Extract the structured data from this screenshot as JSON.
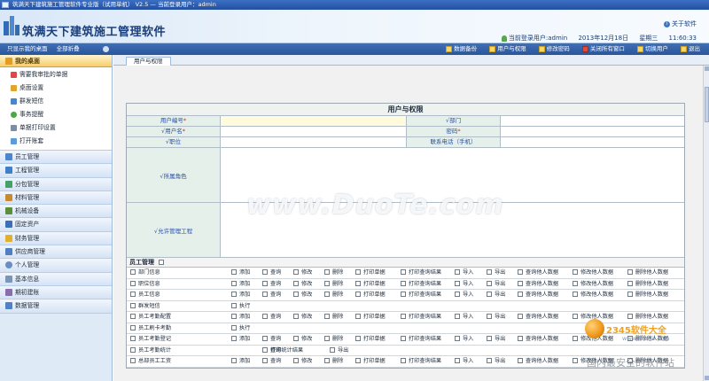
{
  "window": {
    "title": "筑满天下建筑施工管理软件专业版（试用单机） V2.5 —   当前登录用户：admin"
  },
  "header": {
    "app_name": "筑满天下建筑施工管理软件",
    "about_label": "关于软件",
    "current_user_label": "当前登录用户:admin",
    "date": "2013年12月18日",
    "weekday": "星期三",
    "time": "11:60:33"
  },
  "toolbar": {
    "left_links": [
      "只显示我的桌面",
      "全部折叠"
    ],
    "actions": [
      "数据备份",
      "用户与权限",
      "修改密码",
      "关闭所有窗口",
      "切换用户",
      "退出"
    ]
  },
  "sidebar": {
    "my_desktop": {
      "label": "我的桌面",
      "items": [
        "需要我审批的单据",
        "桌面设置",
        "群发短信",
        "事务提醒",
        "单据打印设置",
        "打开账套"
      ]
    },
    "modules": [
      "员工管理",
      "工程管理",
      "分包管理",
      "材料管理",
      "机械设备",
      "固定资产",
      "财务管理",
      "供应商管理",
      "个人管理",
      "基本信息",
      "期初建账",
      "数据管理"
    ]
  },
  "tab": {
    "label": "用户与权限"
  },
  "form": {
    "title": "用户与权限",
    "fields": {
      "user_no": "用户编号",
      "dept": "√部门",
      "username": "√用户名",
      "password": "密码",
      "position": "√职位",
      "phone": "联系电话（手机）",
      "roles": "√所属角色",
      "projects": "√允许管理工程"
    },
    "required_mark": "*",
    "perm_section": "员工管理",
    "perm_rows": [
      {
        "name": "部门信息",
        "ops": [
          "添加",
          "查询",
          "修改",
          "删除",
          "打印单据",
          "打印查询结果",
          "导入",
          "导出",
          "查询他人数据",
          "修改他人数据",
          "删除他人数据"
        ]
      },
      {
        "name": "职位信息",
        "ops": [
          "添加",
          "查询",
          "修改",
          "删除",
          "打印单据",
          "打印查询结果",
          "导入",
          "导出",
          "查询他人数据",
          "修改他人数据",
          "删除他人数据"
        ]
      },
      {
        "name": "员工信息",
        "ops": [
          "添加",
          "查询",
          "修改",
          "删除",
          "打印单据",
          "打印查询结果",
          "导入",
          "导出",
          "查询他人数据",
          "修改他人数据",
          "删除他人数据"
        ]
      },
      {
        "name": "群发短信",
        "ops": [
          "执行"
        ]
      },
      {
        "name": "员工考勤配置",
        "ops": [
          "添加",
          "查询",
          "修改",
          "删除",
          "打印单据",
          "打印查询结果",
          "导入",
          "导出",
          "查询他人数据",
          "修改他人数据",
          "删除他人数据"
        ]
      },
      {
        "name": "员工刷卡考勤",
        "ops": [
          "执行"
        ]
      },
      {
        "name": "员工考勤登记",
        "ops": [
          "添加",
          "查询",
          "修改",
          "删除",
          "打印单据",
          "打印查询结果",
          "导入",
          "导出",
          "查询他人数据",
          "修改他人数据",
          "删除他人数据"
        ]
      },
      {
        "name": "员工考勤统计",
        "ops": [
          "查询",
          "打印统计结果",
          "导出"
        ]
      },
      {
        "name": "总部员工工资",
        "ops": [
          "添加",
          "查询",
          "修改",
          "删除",
          "打印单据",
          "打印查询结果",
          "导入",
          "导出",
          "查询他人数据",
          "修改他人数据",
          "删除他人数据"
        ]
      }
    ]
  },
  "watermarks": {
    "center": "www.DuoTe.com",
    "corner_title": "2345软件大全",
    "corner_url": "www.DuoTe.com",
    "corner_tagline": "国内最安全的软件站"
  },
  "colors": {
    "toolbar_blue": "#2a5599",
    "sidebar_active": "#f6cd6b",
    "label_green": "#e5f0ea",
    "label_text": "#2b4fa3"
  }
}
